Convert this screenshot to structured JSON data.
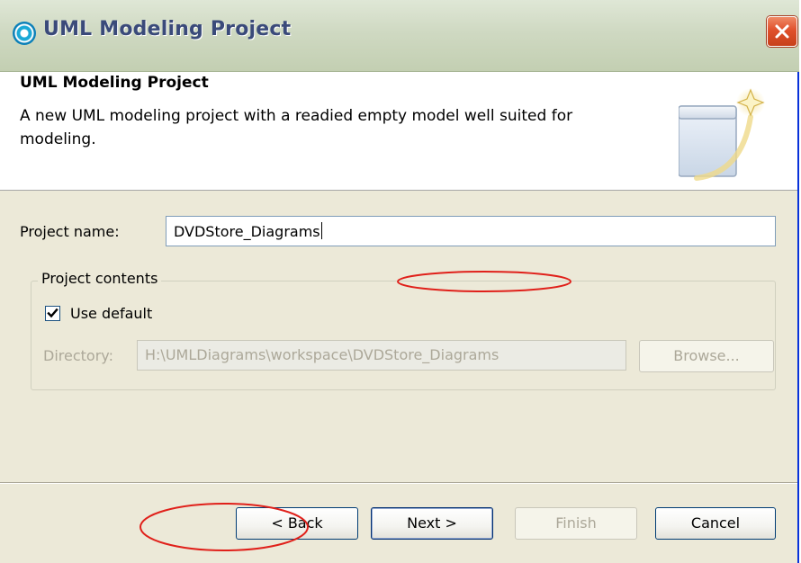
{
  "window": {
    "title": "UML Modeling Project"
  },
  "header": {
    "title": "UML Modeling Project",
    "description": "A new UML modeling project with a readied empty model well suited for modeling."
  },
  "form": {
    "project_name_label": "Project name:",
    "project_name_value": "DVDStore_Diagrams",
    "contents_group_label": "Project contents",
    "use_default_label": "Use default",
    "use_default_checked": true,
    "directory_label": "Directory:",
    "directory_value": "H:\\UMLDiagrams\\workspace\\DVDStore_Diagrams",
    "browse_label": "Browse..."
  },
  "buttons": {
    "back_label": "< Back",
    "next_label": "Next >",
    "finish_label": "Finish",
    "cancel_label": "Cancel"
  },
  "colors": {
    "annotation": "#e0201a",
    "titlebar": "#cfd9c2",
    "dialog_background": "#ece9d8",
    "close_button": "#e0512c"
  },
  "icons": {
    "title": "uml-project-icon",
    "close": "close-icon",
    "wizard": "new-project-wizard-icon",
    "checkbox": "checkmark-icon"
  }
}
